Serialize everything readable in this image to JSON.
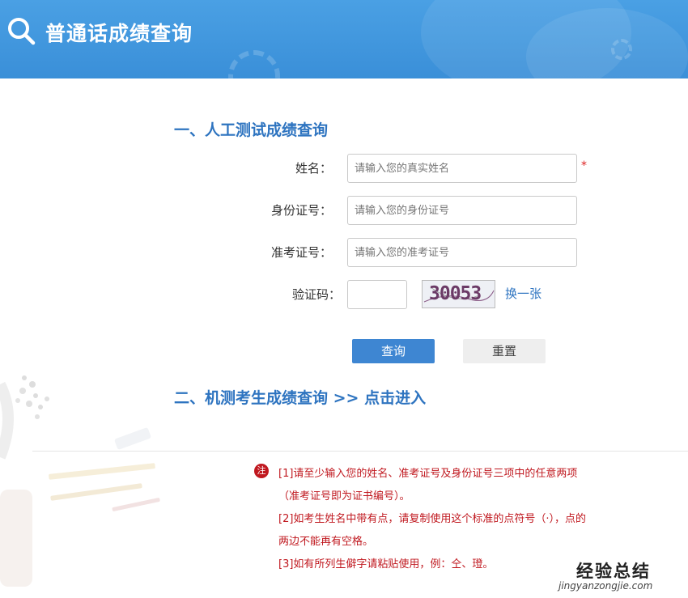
{
  "header": {
    "title": "普通话成绩查询",
    "bg_color": "#3a8fd8"
  },
  "section1": {
    "title": "一、人工测试成绩查询"
  },
  "form": {
    "name_label": "姓名：",
    "name_placeholder": "请输入您的真实姓名",
    "required_mark": "*",
    "id_label": "身份证号：",
    "id_placeholder": "请输入您的身份证号",
    "exam_label": "准考证号：",
    "exam_placeholder": "请输入您的准考证号",
    "captcha_label": "验证码：",
    "captcha_text": "30053",
    "change_link": "换一张"
  },
  "buttons": {
    "query": "查询",
    "reset": "重置"
  },
  "section2": {
    "title": "二、机测考生成绩查询 >> 点击进入"
  },
  "notes": {
    "badge": "注",
    "lines": [
      "[1]请至少输入您的姓名、准考证号及身份证号三项中的任意两项",
      "（准考证号即为证书编号）。",
      "[2]如考生姓名中带有点，请复制使用这个标准的点符号（·），点的",
      "两边不能再有空格。",
      "[3]如有所列生僻字请粘贴使用，例：仝、璒。"
    ]
  },
  "watermark": {
    "cn": "经验总结",
    "en": "jingyanzongjie.com"
  },
  "colors": {
    "accent": "#2e74c0",
    "note_red": "#c0181f"
  }
}
